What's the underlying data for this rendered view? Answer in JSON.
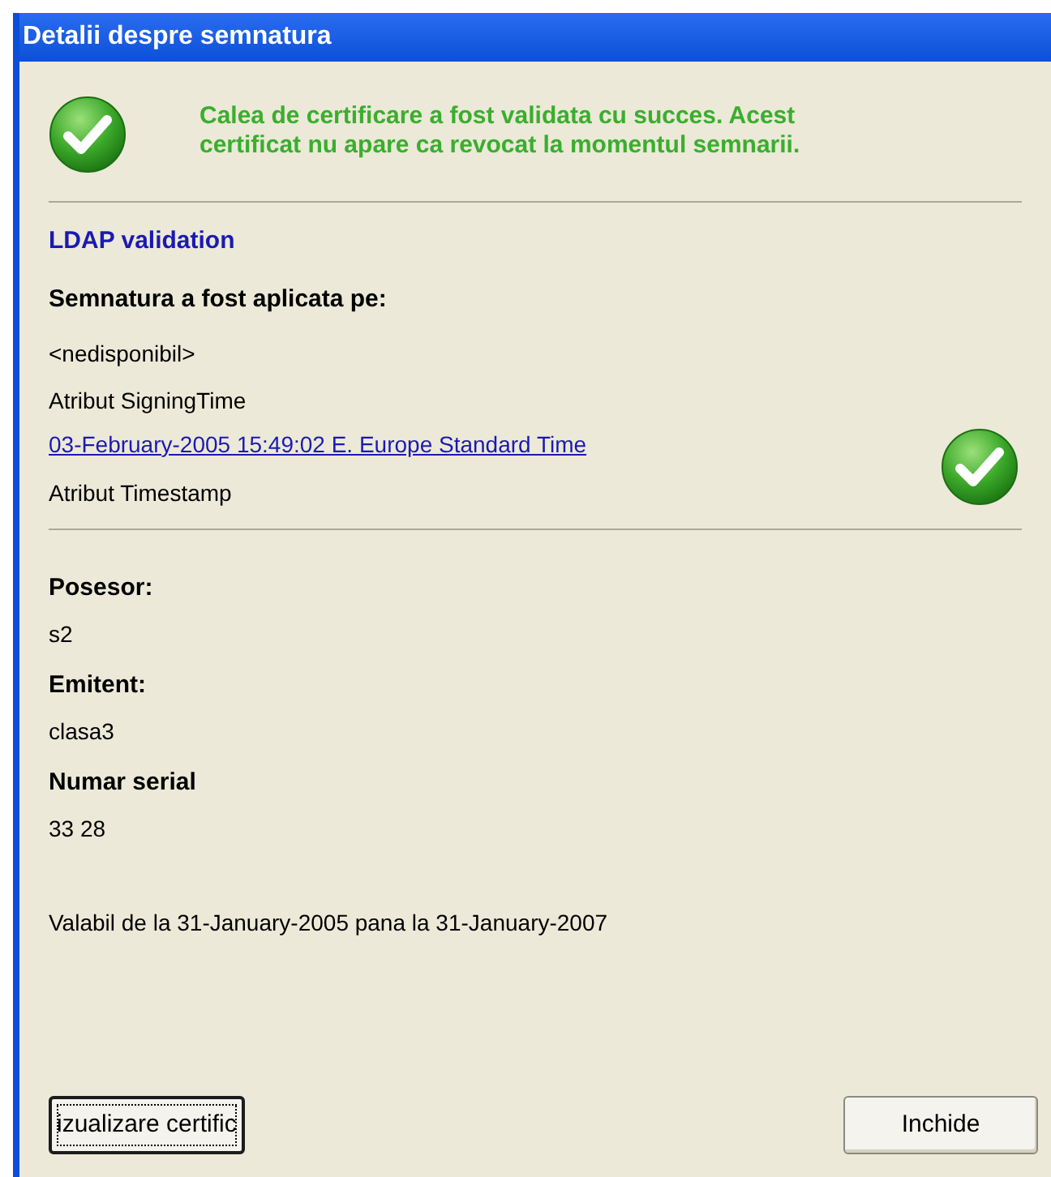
{
  "window": {
    "title": "Detalii despre semnatura"
  },
  "status": {
    "kind": "success",
    "message": "Calea de certificare a fost validata cu succes. Acest certificat nu apare ca revocat la momentul semnarii."
  },
  "validation_heading": "LDAP validation",
  "signature": {
    "heading": "Semnatura a fost aplicata pe:",
    "signing_time": "<nedisponibil>",
    "signing_time_label": "Atribut SigningTime",
    "timestamp": "03-February-2005 15:49:02 E. Europe Standard Time",
    "timestamp_label": "Atribut Timestamp",
    "timestamp_valid": true
  },
  "fields": [
    {
      "label": "Posesor:",
      "value": "s2"
    },
    {
      "label": "Emitent:",
      "value": "clasa3"
    },
    {
      "label": "Numar serial",
      "value": "33 28"
    }
  ],
  "validity": "Valabil de la 31-January-2005 pana la 31-January-2007",
  "buttons": [
    {
      "label": "izualizare certific",
      "focused": true
    },
    {
      "label": "Inchide",
      "focused": false
    }
  ]
}
